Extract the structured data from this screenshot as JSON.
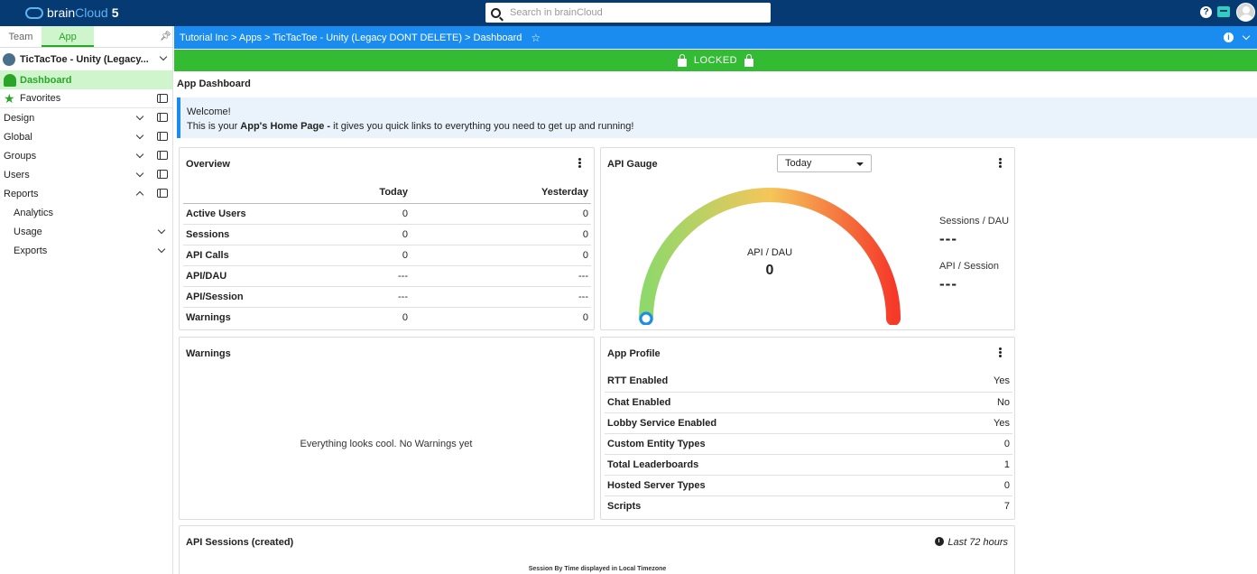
{
  "topbar": {
    "brand_prefix": "brain",
    "brand_suffix": "Cloud",
    "version": "5",
    "search_placeholder": "Search in brainCloud",
    "help_glyph": "?"
  },
  "sidebar": {
    "tabs": [
      {
        "label": "Team",
        "active": false
      },
      {
        "label": "App",
        "active": true
      }
    ],
    "pin_glyph": "✦",
    "app_name": "TicTacToe - Unity (Legacy...",
    "items": [
      {
        "label": "Dashboard",
        "icon": "dashboard-icon",
        "active": true
      },
      {
        "label": "Favorites",
        "icon": "star-icon"
      },
      {
        "label": "Design"
      },
      {
        "label": "Global"
      },
      {
        "label": "Groups"
      },
      {
        "label": "Users"
      },
      {
        "label": "Reports",
        "expanded": true
      }
    ],
    "subitems": [
      {
        "label": "Analytics"
      },
      {
        "label": "Usage"
      },
      {
        "label": "Exports"
      }
    ]
  },
  "breadcrumb": {
    "text": "Tutorial Inc > Apps > TicTacToe - Unity (Legacy DONT DELETE) > Dashboard",
    "star_glyph": "☆",
    "info_glyph": "i"
  },
  "locked_label": "LOCKED",
  "page_title": "App Dashboard",
  "welcome": {
    "line1": "Welcome!",
    "line2_prefix": "This is your ",
    "line2_bold": "App's Home Page - ",
    "line2_suffix": "it gives you quick links to everything you need to get up and running!"
  },
  "overview": {
    "title": "Overview",
    "col_today": "Today",
    "col_yesterday": "Yesterday",
    "rows": [
      {
        "label": "Active Users",
        "today": "0",
        "yesterday": "0"
      },
      {
        "label": "Sessions",
        "today": "0",
        "yesterday": "0"
      },
      {
        "label": "API Calls",
        "today": "0",
        "yesterday": "0"
      },
      {
        "label": "API/DAU",
        "today": "---",
        "yesterday": "---"
      },
      {
        "label": "API/Session",
        "today": "---",
        "yesterday": "---"
      },
      {
        "label": "Warnings",
        "today": "0",
        "yesterday": "0"
      }
    ]
  },
  "gauge": {
    "title": "API Gauge",
    "period": "Today",
    "center_label": "API / DAU",
    "center_value": "0",
    "value_fraction": 0,
    "colors": {
      "low": "#8fd86a",
      "mid": "#f5c65a",
      "high": "#f53a2a",
      "marker": "#1a8cf0"
    },
    "sessions_dau_label": "Sessions / DAU",
    "sessions_dau_value": "---",
    "api_session_label": "API / Session",
    "api_session_value": "---"
  },
  "warnings": {
    "title": "Warnings",
    "message": "Everything looks cool. No Warnings yet"
  },
  "profile": {
    "title": "App Profile",
    "rows": [
      {
        "label": "RTT Enabled",
        "value": "Yes"
      },
      {
        "label": "Chat Enabled",
        "value": "No"
      },
      {
        "label": "Lobby Service Enabled",
        "value": "Yes"
      },
      {
        "label": "Custom Entity Types",
        "value": "0"
      },
      {
        "label": "Total Leaderboards",
        "value": "1"
      },
      {
        "label": "Hosted Server Types",
        "value": "0"
      },
      {
        "label": "Scripts",
        "value": "7"
      }
    ]
  },
  "sessions_chart": {
    "title": "API Sessions (created)",
    "range": "Last 72 hours",
    "subtitle": "Session By Time displayed in Local Timezone"
  }
}
